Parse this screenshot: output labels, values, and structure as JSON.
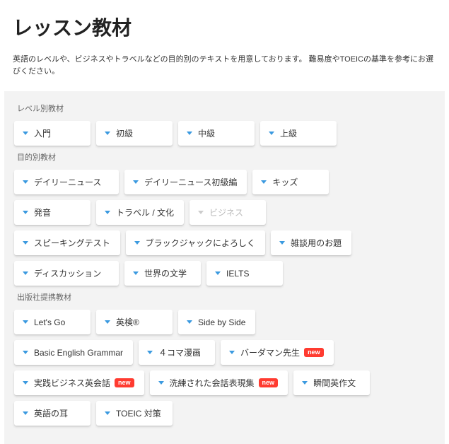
{
  "title": "レッスン教材",
  "description": "英語のレベルや、ビジネスやトラベルなどの目的別のテキストを用意しております。 難易度やTOEICの基準を参考にお選びください。",
  "badge_new": "new",
  "sections": {
    "level": {
      "heading": "レベル別教材",
      "items": [
        "入門",
        "初級",
        "中級",
        "上級"
      ]
    },
    "purpose": {
      "heading": "目的別教材",
      "rows": [
        [
          {
            "label": "デイリーニュース"
          },
          {
            "label": "デイリーニュース初級編"
          },
          {
            "label": "キッズ"
          }
        ],
        [
          {
            "label": "発音"
          },
          {
            "label": "トラベル / 文化"
          },
          {
            "label": "ビジネス",
            "disabled": true
          }
        ],
        [
          {
            "label": "スピーキングテスト"
          },
          {
            "label": "ブラックジャックによろしく"
          },
          {
            "label": "雑談用のお題"
          }
        ],
        [
          {
            "label": "ディスカッション"
          },
          {
            "label": "世界の文学"
          },
          {
            "label": "IELTS"
          }
        ]
      ]
    },
    "publisher": {
      "heading": "出版社提携教材",
      "rows": [
        [
          {
            "label": "Let's Go"
          },
          {
            "label": "英検®"
          },
          {
            "label": "Side by Side"
          }
        ],
        [
          {
            "label": "Basic English Grammar"
          },
          {
            "label": "４コマ漫画"
          },
          {
            "label": "バーダマン先生",
            "new": true
          }
        ],
        [
          {
            "label": "実践ビジネス英会話",
            "new": true
          },
          {
            "label": "洗練された会話表現集",
            "new": true
          },
          {
            "label": "瞬間英作文"
          }
        ],
        [
          {
            "label": "英語の耳"
          },
          {
            "label": "TOEIC 対策"
          }
        ]
      ]
    }
  }
}
